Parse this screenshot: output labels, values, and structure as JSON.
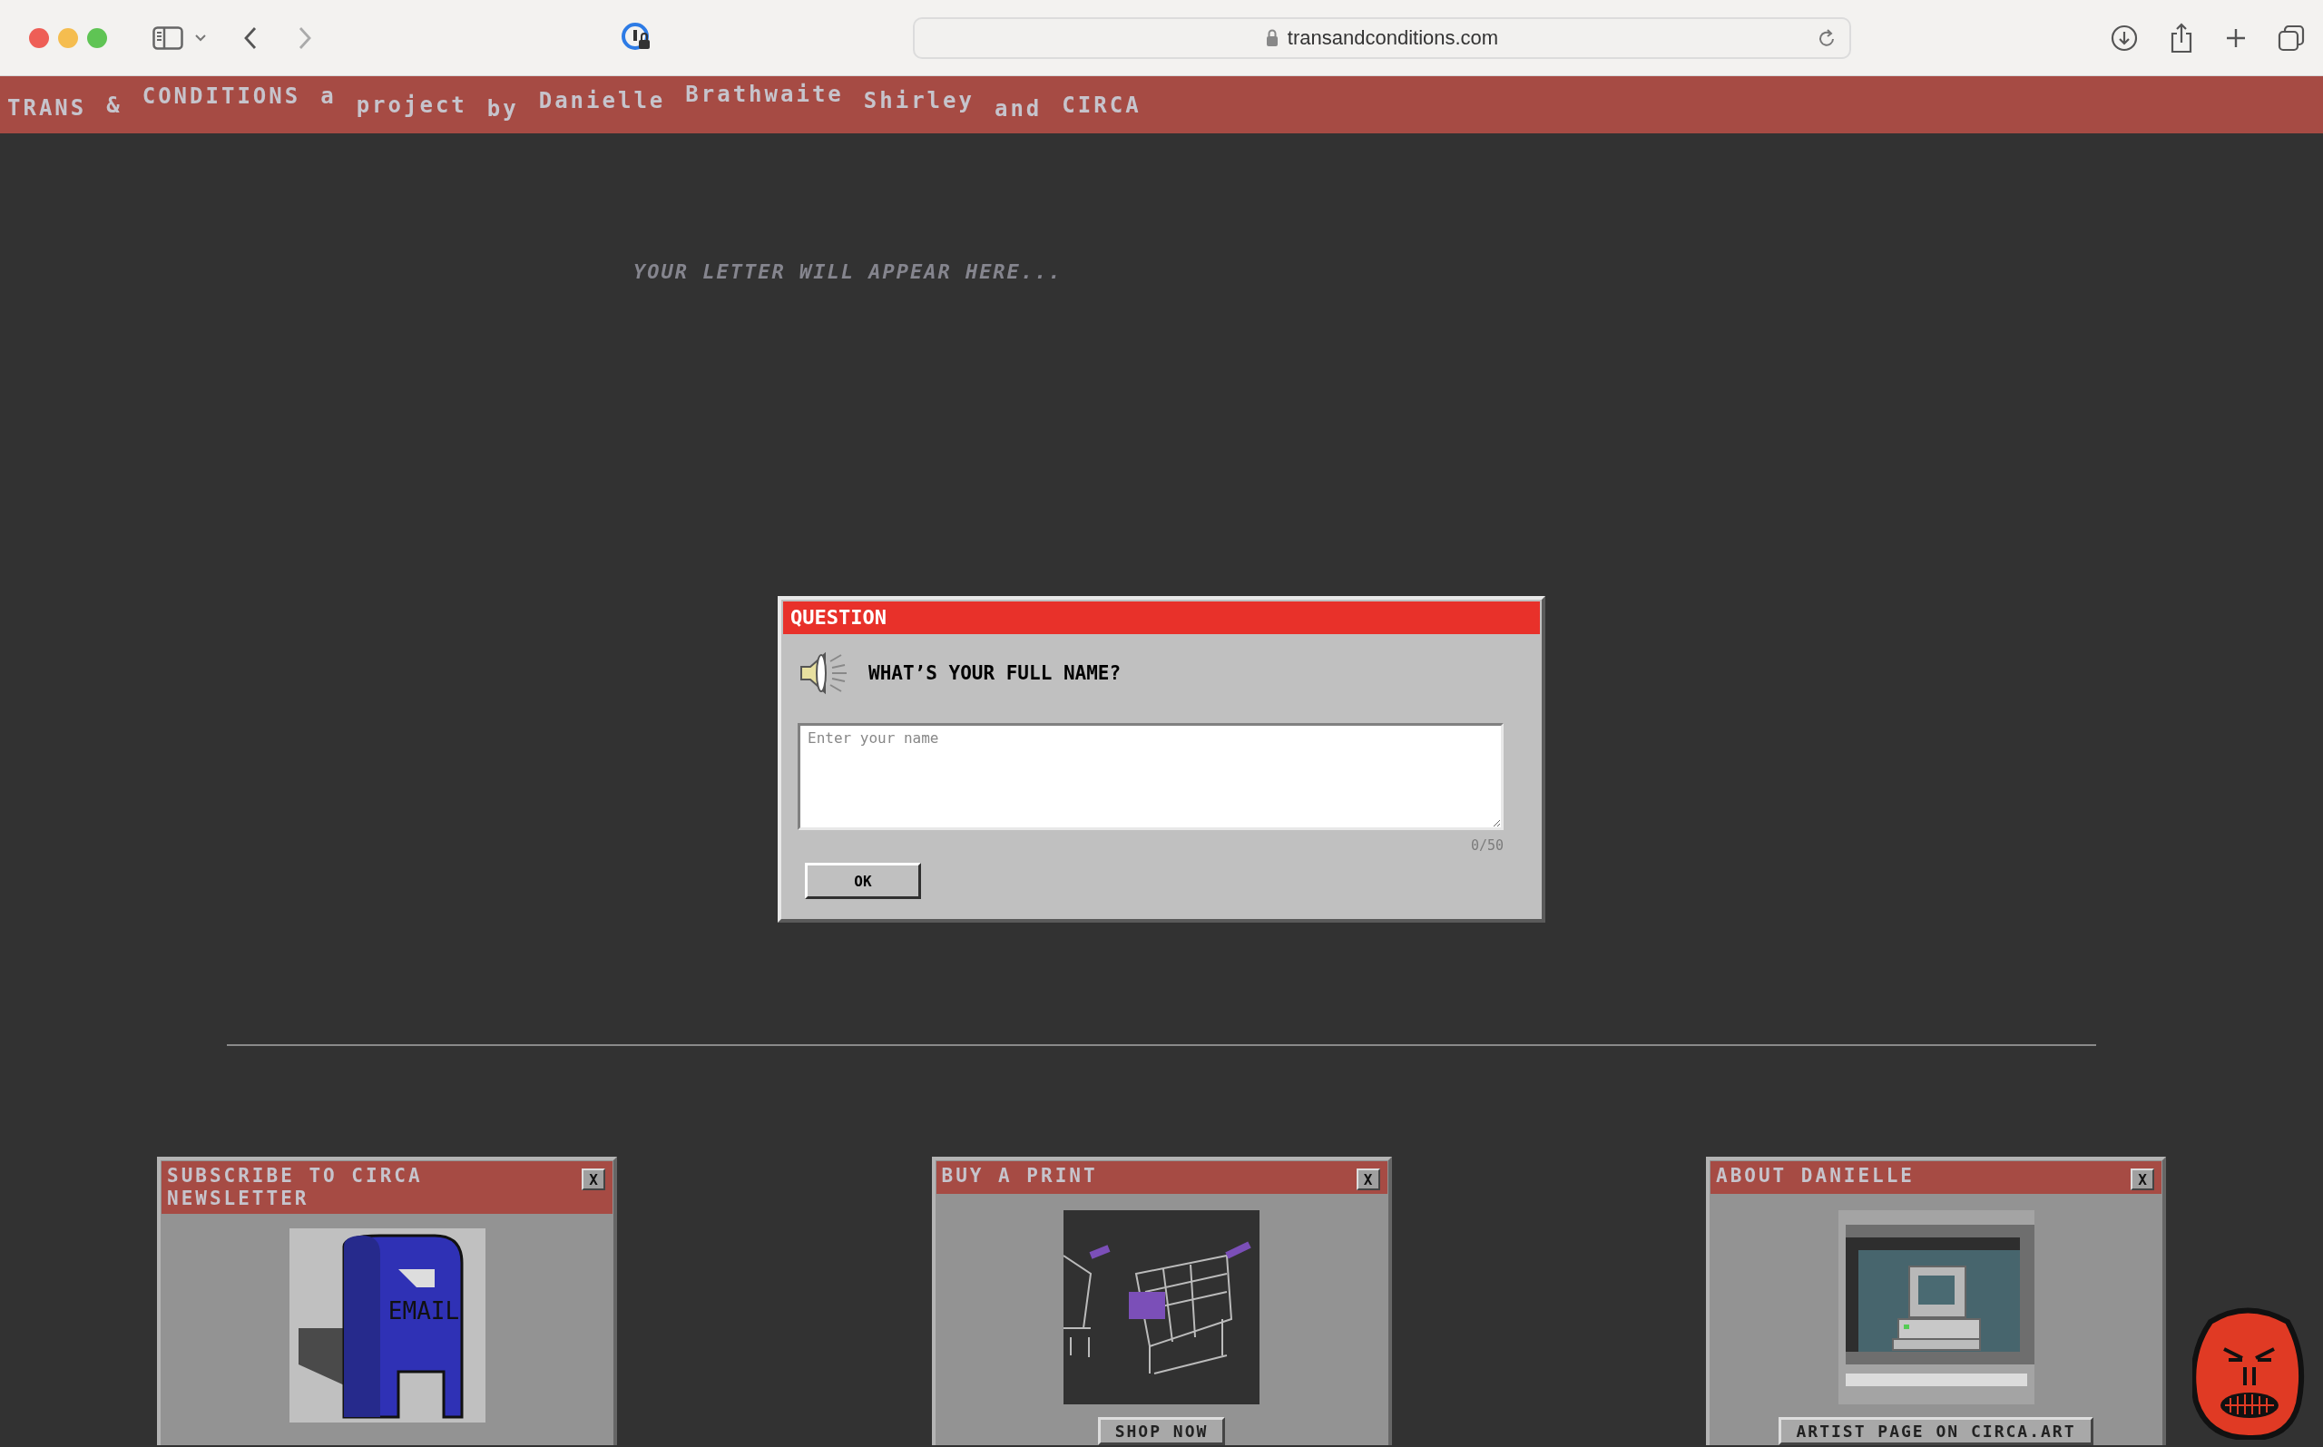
{
  "browser": {
    "url": "transandconditions.com"
  },
  "header": {
    "words": [
      "TRANS",
      "&",
      "CONDITIONS",
      "a",
      "project",
      "by",
      "Danielle",
      "Brathwaite",
      "Shirley",
      "and",
      "CIRCA"
    ]
  },
  "letter": {
    "message": "YOUR LETTER WILL APPEAR HERE..."
  },
  "dialog": {
    "title": "QUESTION",
    "question": "WHAT’S YOUR FULL NAME?",
    "field": {
      "placeholder": "Enter your name"
    },
    "counter": "0/50",
    "button": "OK"
  },
  "cards": [
    {
      "kind": "mailbox",
      "title": "SUBSCRIBE TO CIRCA NEWSLETTER",
      "close": "X",
      "image_text": "EMAIL"
    },
    {
      "kind": "carts",
      "title": "BUY A PRINT",
      "close": "X",
      "button": "SHOP NOW"
    },
    {
      "kind": "computer",
      "title": "ABOUT DANIELLE",
      "close": "X",
      "button": "ARTIST PAGE ON CIRCA.ART"
    }
  ]
}
